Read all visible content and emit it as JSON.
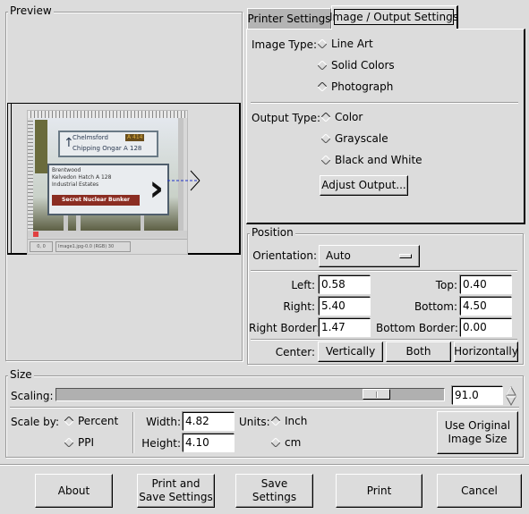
{
  "preview": {
    "title": "Preview",
    "thumbnail": {
      "description": "Road sign photo thumbnail",
      "sign_lines_top": [
        "Chelmsford",
        "A 414",
        "Chipping Ongar A 128"
      ],
      "sign_lines_main": [
        "Brentwood",
        "Kelvedon Hatch A 128",
        "Industrial Estates"
      ],
      "sign_banner": "Secret Nuclear Bunker",
      "status_text": "Image1.jpg-0.0 (RGB) 30",
      "coord_text": "0, 0"
    }
  },
  "tabs": [
    {
      "label": "Printer Settings",
      "active": false
    },
    {
      "label": "Image / Output Settings",
      "active": true
    }
  ],
  "image_type": {
    "label": "Image Type:",
    "options": [
      {
        "label": "Line Art",
        "selected": false
      },
      {
        "label": "Solid Colors",
        "selected": false
      },
      {
        "label": "Photograph",
        "selected": true
      }
    ]
  },
  "output_type": {
    "label": "Output Type:",
    "options": [
      {
        "label": "Color",
        "selected": true
      },
      {
        "label": "Grayscale",
        "selected": false
      },
      {
        "label": "Black and White",
        "selected": false
      }
    ],
    "adjust_button": "Adjust Output..."
  },
  "position": {
    "title": "Position",
    "orientation_label": "Orientation:",
    "orientation_value": "Auto",
    "fields": {
      "left": {
        "label": "Left:",
        "value": "0.58"
      },
      "top": {
        "label": "Top:",
        "value": "0.40"
      },
      "right": {
        "label": "Right:",
        "value": "5.40"
      },
      "bottom": {
        "label": "Bottom:",
        "value": "4.50"
      },
      "right_border": {
        "label": "Right Border:",
        "value": "1.47"
      },
      "bottom_border": {
        "label": "Bottom Border:",
        "value": "0.00"
      }
    },
    "center_label": "Center:",
    "center_buttons": [
      "Vertically",
      "Both",
      "Horizontally"
    ]
  },
  "size": {
    "title": "Size",
    "scaling_label": "Scaling:",
    "scaling_value": "91.0",
    "scaling_fraction": 0.85,
    "scale_by_label": "Scale by:",
    "scale_by_options": [
      {
        "label": "Percent",
        "selected": true
      },
      {
        "label": "PPI",
        "selected": false
      }
    ],
    "width_label": "Width:",
    "width_value": "4.82",
    "height_label": "Height:",
    "height_value": "4.10",
    "units_label": "Units:",
    "units_options": [
      {
        "label": "Inch",
        "selected": true
      },
      {
        "label": "cm",
        "selected": false
      }
    ],
    "original_size_button": "Use Original\nImage Size"
  },
  "buttons": {
    "about": "About",
    "print_and_save": "Print and\nSave Settings",
    "save_settings": "Save\nSettings",
    "print": "Print",
    "cancel": "Cancel"
  }
}
